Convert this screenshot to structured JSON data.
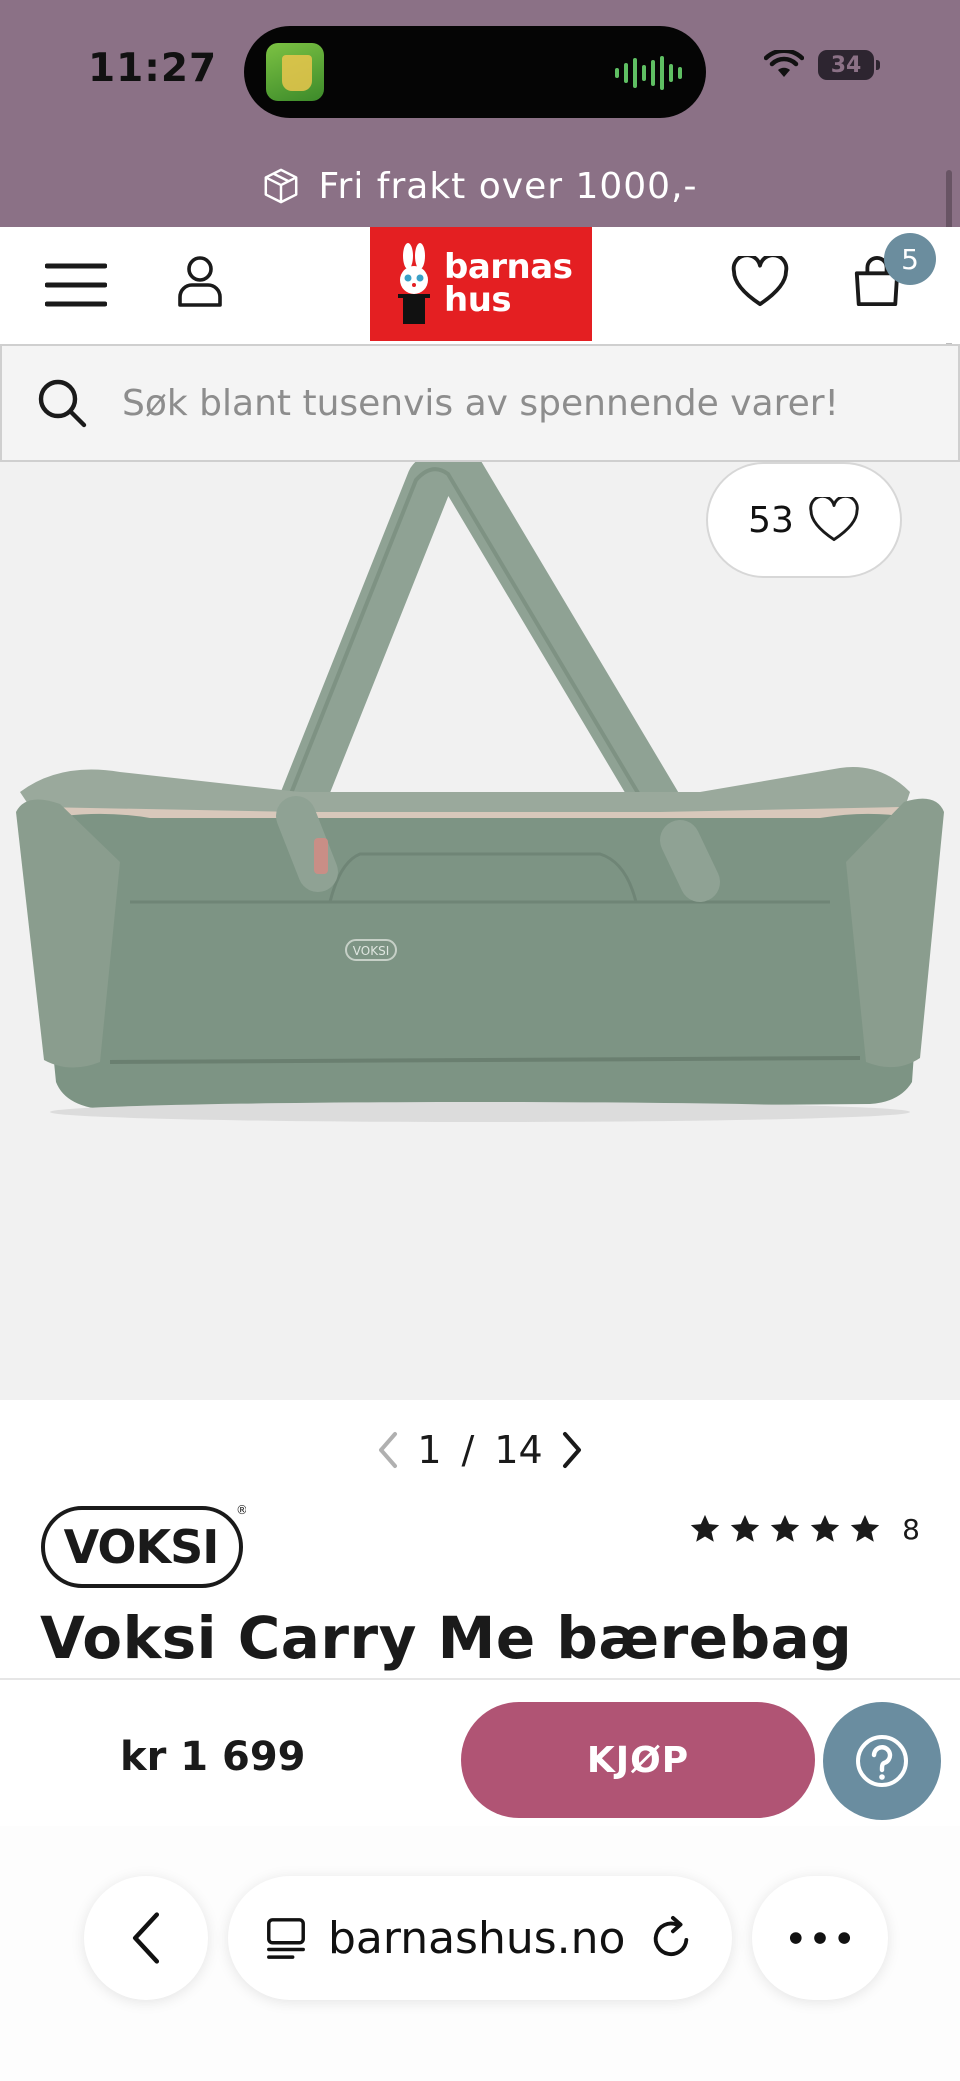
{
  "status_bar": {
    "time": "11:27",
    "battery": "34",
    "icons": [
      "wifi-icon",
      "battery-icon"
    ]
  },
  "promo": {
    "icon": "package-icon",
    "text": "Fri frakt over 1000,-"
  },
  "header": {
    "menu_icon": "hamburger-menu-icon",
    "account_icon": "user-icon",
    "logo_line1": "barnas",
    "logo_line2": "hus",
    "wishlist_icon": "heart-icon",
    "cart_icon": "shopping-bag-icon",
    "cart_count": "5"
  },
  "search": {
    "placeholder": "Søk blant tusenvis av spennende varer!"
  },
  "product": {
    "likes": "53",
    "image_current": "1",
    "image_total": "14",
    "brand": "VOKSI",
    "brand_mark": "®",
    "bag_print": "VOKSI",
    "rating_stars": 5,
    "rating_count": "8",
    "title": "Voksi Carry Me bærebag",
    "price": "kr 1 699",
    "buy_label": "KJØP"
  },
  "browser": {
    "url": "barnashus.no"
  },
  "colors": {
    "top_band": "#8b7186",
    "logo_red": "#e41f22",
    "buy_button": "#b05474",
    "help_button": "#6a8da0",
    "bag_green": "#7d9484"
  }
}
